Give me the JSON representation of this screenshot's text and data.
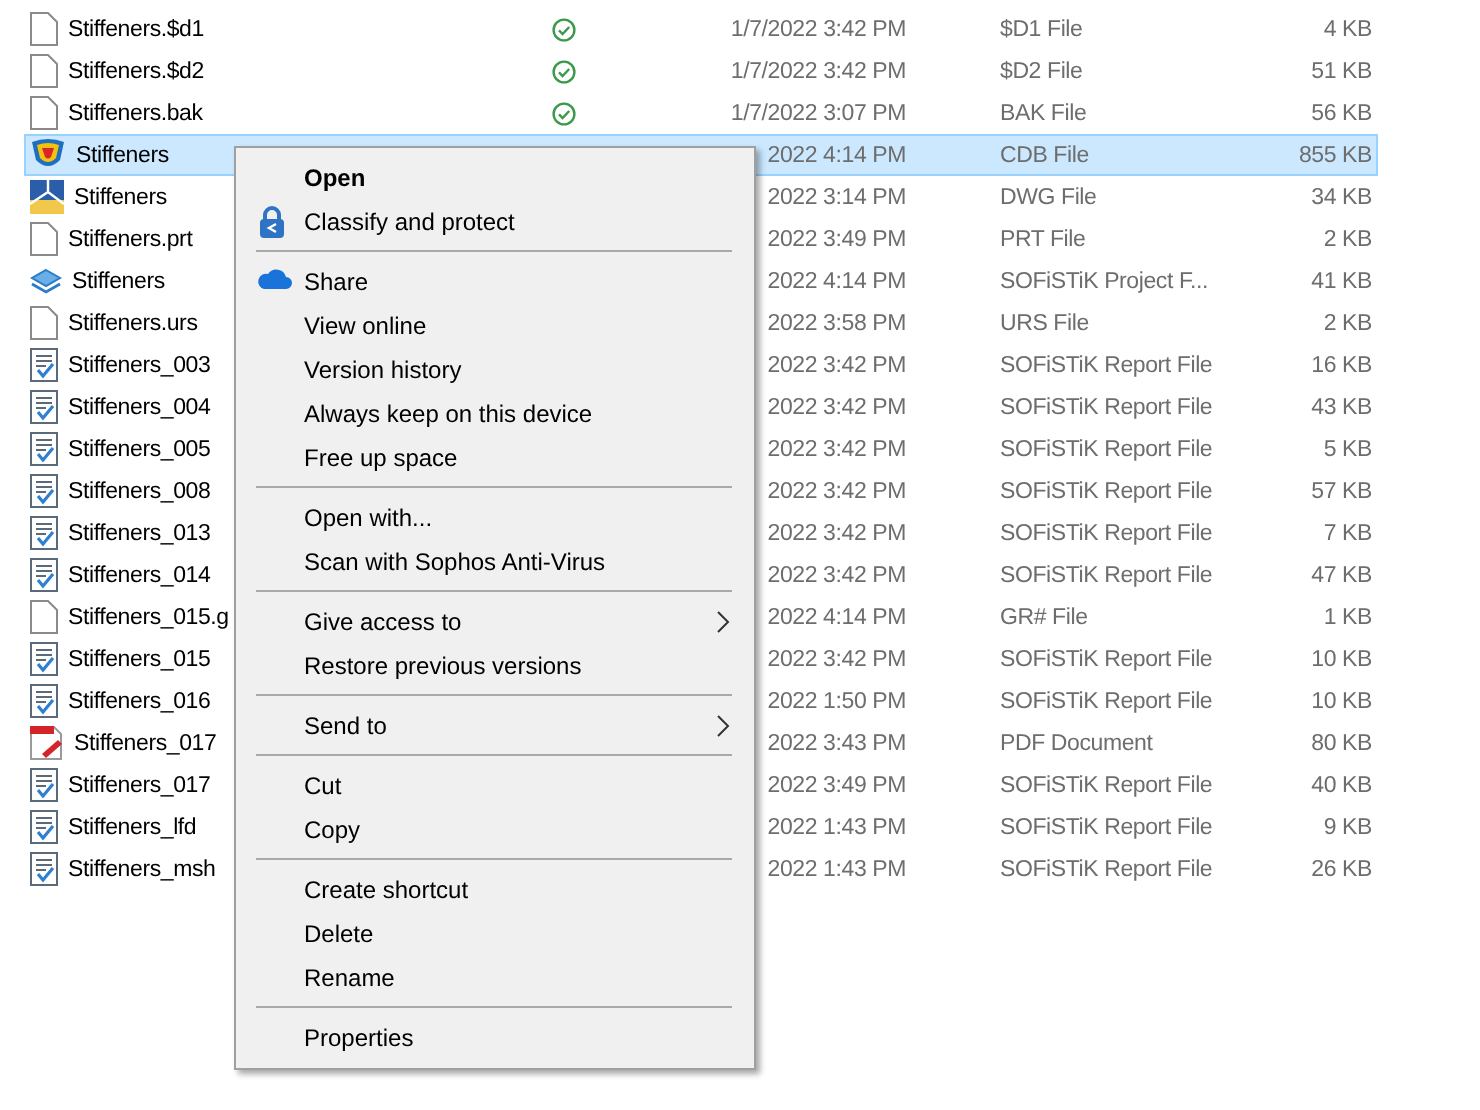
{
  "files": [
    {
      "kind": "blank",
      "name": "Stiffeners.$d1",
      "synced": true,
      "selected": false,
      "date": "1/7/2022 3:42 PM",
      "type": "$D1 File",
      "size": "4 KB"
    },
    {
      "kind": "blank",
      "name": "Stiffeners.$d2",
      "synced": true,
      "selected": false,
      "date": "1/7/2022 3:42 PM",
      "type": "$D2 File",
      "size": "51 KB"
    },
    {
      "kind": "blank",
      "name": "Stiffeners.bak",
      "synced": true,
      "selected": false,
      "date": "1/7/2022 3:07 PM",
      "type": "BAK File",
      "size": "56 KB"
    },
    {
      "kind": "cdb",
      "name": "Stiffeners",
      "synced": false,
      "selected": true,
      "date": "2022 4:14 PM",
      "type": "CDB File",
      "size": "855 KB"
    },
    {
      "kind": "dwg",
      "name": "Stiffeners",
      "synced": false,
      "selected": false,
      "date": "2022 3:14 PM",
      "type": "DWG File",
      "size": "34 KB"
    },
    {
      "kind": "blank",
      "name": "Stiffeners.prt",
      "synced": false,
      "selected": false,
      "date": "2022 3:49 PM",
      "type": "PRT File",
      "size": "2 KB"
    },
    {
      "kind": "project",
      "name": "Stiffeners",
      "synced": false,
      "selected": false,
      "date": "2022 4:14 PM",
      "type": "SOFiSTiK Project F...",
      "size": "41 KB"
    },
    {
      "kind": "blank",
      "name": "Stiffeners.urs",
      "synced": false,
      "selected": false,
      "date": "2022 3:58 PM",
      "type": "URS File",
      "size": "2 KB"
    },
    {
      "kind": "report",
      "name": "Stiffeners_003",
      "synced": false,
      "selected": false,
      "date": "2022 3:42 PM",
      "type": "SOFiSTiK Report File",
      "size": "16 KB"
    },
    {
      "kind": "report",
      "name": "Stiffeners_004",
      "synced": false,
      "selected": false,
      "date": "2022 3:42 PM",
      "type": "SOFiSTiK Report File",
      "size": "43 KB"
    },
    {
      "kind": "report",
      "name": "Stiffeners_005",
      "synced": false,
      "selected": false,
      "date": "2022 3:42 PM",
      "type": "SOFiSTiK Report File",
      "size": "5 KB"
    },
    {
      "kind": "report",
      "name": "Stiffeners_008",
      "synced": false,
      "selected": false,
      "date": "2022 3:42 PM",
      "type": "SOFiSTiK Report File",
      "size": "57 KB"
    },
    {
      "kind": "report",
      "name": "Stiffeners_013",
      "synced": false,
      "selected": false,
      "date": "2022 3:42 PM",
      "type": "SOFiSTiK Report File",
      "size": "7 KB"
    },
    {
      "kind": "report",
      "name": "Stiffeners_014",
      "synced": false,
      "selected": false,
      "date": "2022 3:42 PM",
      "type": "SOFiSTiK Report File",
      "size": "47 KB"
    },
    {
      "kind": "blank",
      "name": "Stiffeners_015.g",
      "synced": false,
      "selected": false,
      "date": "2022 4:14 PM",
      "type": "GR# File",
      "size": "1 KB"
    },
    {
      "kind": "report",
      "name": "Stiffeners_015",
      "synced": false,
      "selected": false,
      "date": "2022 3:42 PM",
      "type": "SOFiSTiK Report File",
      "size": "10 KB"
    },
    {
      "kind": "report",
      "name": "Stiffeners_016",
      "synced": false,
      "selected": false,
      "date": "2022 1:50 PM",
      "type": "SOFiSTiK Report File",
      "size": "10 KB"
    },
    {
      "kind": "pdf",
      "name": "Stiffeners_017",
      "synced": false,
      "selected": false,
      "date": "2022 3:43 PM",
      "type": "PDF Document",
      "size": "80 KB"
    },
    {
      "kind": "report",
      "name": "Stiffeners_017",
      "synced": false,
      "selected": false,
      "date": "2022 3:49 PM",
      "type": "SOFiSTiK Report File",
      "size": "40 KB"
    },
    {
      "kind": "report",
      "name": "Stiffeners_lfd",
      "synced": false,
      "selected": false,
      "date": "2022 1:43 PM",
      "type": "SOFiSTiK Report File",
      "size": "9 KB"
    },
    {
      "kind": "report",
      "name": "Stiffeners_msh",
      "synced": false,
      "selected": false,
      "date": "2022 1:43 PM",
      "type": "SOFiSTiK Report File",
      "size": "26 KB"
    }
  ],
  "context_menu": {
    "groups": [
      [
        {
          "label": "Open",
          "bold": true
        },
        {
          "label": "Classify and protect",
          "kind": "lock"
        }
      ],
      [
        {
          "label": "Share",
          "kind": "cloud"
        },
        {
          "label": "View online"
        },
        {
          "label": "Version history"
        },
        {
          "label": "Always keep on this device"
        },
        {
          "label": "Free up space"
        }
      ],
      [
        {
          "label": "Open with..."
        },
        {
          "label": "Scan with Sophos Anti-Virus"
        }
      ],
      [
        {
          "label": "Give access to",
          "submenu": true
        },
        {
          "label": "Restore previous versions"
        }
      ],
      [
        {
          "label": "Send to",
          "submenu": true
        }
      ],
      [
        {
          "label": "Cut"
        },
        {
          "label": "Copy"
        }
      ],
      [
        {
          "label": "Create shortcut"
        },
        {
          "label": "Delete"
        },
        {
          "label": "Rename"
        }
      ],
      [
        {
          "label": "Properties"
        }
      ]
    ]
  }
}
